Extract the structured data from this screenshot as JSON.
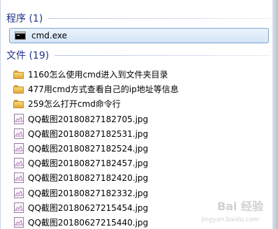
{
  "programs": {
    "header": "程序 (1)",
    "items": [
      {
        "label": "cmd.exe",
        "icon": "cmd-icon"
      }
    ]
  },
  "files": {
    "header": "文件 (19)",
    "items": [
      {
        "label": "1160怎么使用cmd进入到文件夹目录",
        "icon": "folder-icon"
      },
      {
        "label": "477用cmd方式查看自己的ip地址等信息",
        "icon": "folder-icon"
      },
      {
        "label": "259怎么打开cmd命令行",
        "icon": "folder-icon"
      },
      {
        "label": "QQ截图20180827182705.jpg",
        "icon": "image-file-icon"
      },
      {
        "label": "QQ截图20180827182531.jpg",
        "icon": "image-file-icon"
      },
      {
        "label": "QQ截图20180827182524.jpg",
        "icon": "image-file-icon"
      },
      {
        "label": "QQ截图20180827182457.jpg",
        "icon": "image-file-icon"
      },
      {
        "label": "QQ截图20180827182420.jpg",
        "icon": "image-file-icon"
      },
      {
        "label": "QQ截图20180827182332.jpg",
        "icon": "image-file-icon"
      },
      {
        "label": "QQ截图20180627215454.jpg",
        "icon": "image-file-icon"
      },
      {
        "label": "QQ截图20180627215440.jpg",
        "icon": "image-file-icon"
      }
    ]
  },
  "watermark": {
    "text": "Bai 经验",
    "sub": "jingyan.baidu.com"
  },
  "colors": {
    "header_text": "#1e3287",
    "selection_border": "#7da2ce",
    "selection_fill": "#d3e5f7"
  }
}
